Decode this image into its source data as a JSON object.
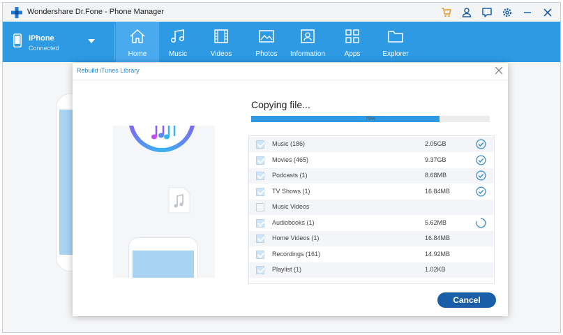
{
  "app": {
    "title": "Wondershare Dr.Fone - Phone Manager"
  },
  "window_controls": [
    "cart-icon",
    "user-icon",
    "feedback-icon",
    "gear-icon",
    "minimize-icon",
    "close-icon"
  ],
  "device": {
    "name": "iPhone",
    "status": "Connected"
  },
  "nav": {
    "active": "Home",
    "tabs": [
      {
        "label": "Home",
        "icon": "home-icon"
      },
      {
        "label": "Music",
        "icon": "music-icon"
      },
      {
        "label": "Videos",
        "icon": "film-icon"
      },
      {
        "label": "Photos",
        "icon": "image-icon"
      },
      {
        "label": "Information",
        "icon": "contact-card-icon"
      },
      {
        "label": "Apps",
        "icon": "apps-grid-icon"
      },
      {
        "label": "Explorer",
        "icon": "folder-icon"
      }
    ]
  },
  "dialog": {
    "title": "Rebuild iTunes Library",
    "copying_label": "Copying file...",
    "progress": {
      "percent": 79,
      "label": "79%"
    },
    "items": [
      {
        "name": "Music (186)",
        "size": "2.05GB",
        "checked": true,
        "status": "done"
      },
      {
        "name": "Movies (465)",
        "size": "9.37GB",
        "checked": true,
        "status": "done"
      },
      {
        "name": "Podcasts (1)",
        "size": "8.68MB",
        "checked": true,
        "status": "done"
      },
      {
        "name": "TV Shows (1)",
        "size": "16.84MB",
        "checked": true,
        "status": "done"
      },
      {
        "name": "Music Videos",
        "size": "",
        "checked": false,
        "status": "none"
      },
      {
        "name": "Audiobooks (1)",
        "size": "5.62MB",
        "checked": true,
        "status": "in-progress"
      },
      {
        "name": "Home Videos (1)",
        "size": "16.84MB",
        "checked": true,
        "status": "none"
      },
      {
        "name": "Recordings (161)",
        "size": "14.92MB",
        "checked": true,
        "status": "none"
      },
      {
        "name": "Playlist (1)",
        "size": "1.02KB",
        "checked": true,
        "status": "none"
      }
    ],
    "cancel_label": "Cancel"
  },
  "colors": {
    "accent": "#2d9ae3",
    "nav_active": "#4aaaf0",
    "button": "#1a5ea8",
    "check_done": "#2d8ad0"
  }
}
